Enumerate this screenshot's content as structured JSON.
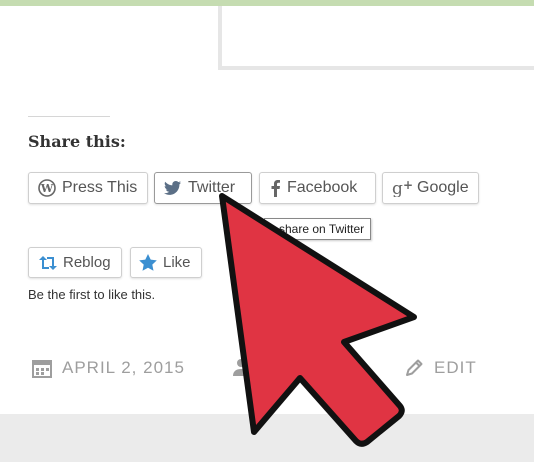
{
  "share": {
    "title": "Share this:",
    "buttons": {
      "press_this": "Press This",
      "twitter": "Twitter",
      "facebook": "Facebook",
      "google": "Google",
      "google_prefix": "g+"
    },
    "tooltip": "share on Twitter"
  },
  "likes": {
    "reblog": "Reblog",
    "like": "Like",
    "text": "Be the first to like this."
  },
  "meta": {
    "date": "APRIL 2, 2015",
    "edit": "EDIT"
  },
  "colors": {
    "accent_blue": "#3b8fd1",
    "cursor_red": "#e03443",
    "twitter_icon": "#5b6f86"
  },
  "icons": {
    "press_this": "wordpress-icon",
    "twitter": "twitter-bird-icon",
    "facebook": "facebook-icon",
    "google": "google-plus-icon",
    "reblog": "reblog-icon",
    "like": "star-icon",
    "date": "calendar-icon",
    "author": "person-icon",
    "edit": "pencil-icon",
    "pointer": "mouse-pointer-icon"
  }
}
